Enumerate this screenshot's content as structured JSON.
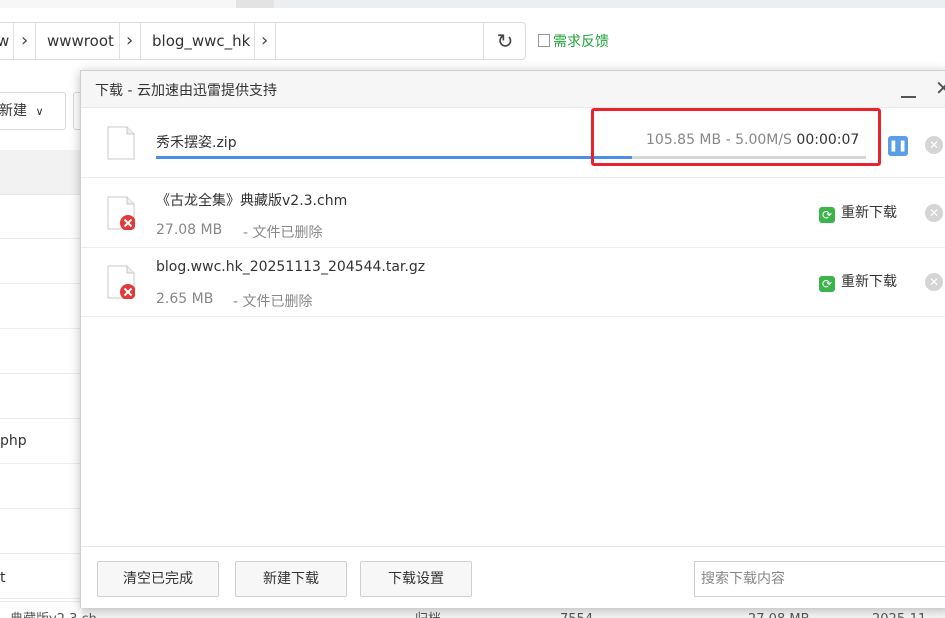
{
  "breadcrumb": {
    "items": [
      "w",
      "wwwroot",
      "blog_wwc_hk"
    ],
    "refresh_icon": "refresh-icon"
  },
  "feedback": {
    "label": "需求反馈"
  },
  "left_toolbar": {
    "new_label": "新建"
  },
  "left_rows": [
    "php",
    "t"
  ],
  "bottom_row": [
    "典藏版v2.3.ch",
    "归档",
    "7554",
    "27.08 MB",
    "2025-11"
  ],
  "dialog": {
    "title": "下载 - 云加速由迅雷提供支持",
    "downloads": [
      {
        "name": "秀禾摆姿.zip",
        "status": "downloading",
        "size": "105.85 MB",
        "speed": "5.00M/S",
        "eta": "00:00:07",
        "progress": 0.67
      },
      {
        "name": "《古龙全集》典藏版v2.3.chm",
        "status": "error",
        "size": "27.08 MB",
        "state_text": "- 文件已删除",
        "action": "重新下载"
      },
      {
        "name": "blog.wwc.hk_20251113_204544.tar.gz",
        "status": "error",
        "size": "2.65 MB",
        "state_text": "- 文件已删除",
        "action": "重新下载"
      }
    ],
    "footer": {
      "clear_label": "清空已完成",
      "new_label": "新建下载",
      "settings_label": "下载设置",
      "search_placeholder": "搜索下载内容"
    }
  },
  "colors": {
    "accent_green": "#20a53a",
    "progress_blue": "#4a8ee8",
    "highlight_red": "#e8232f",
    "error_red": "#e23a3a"
  }
}
